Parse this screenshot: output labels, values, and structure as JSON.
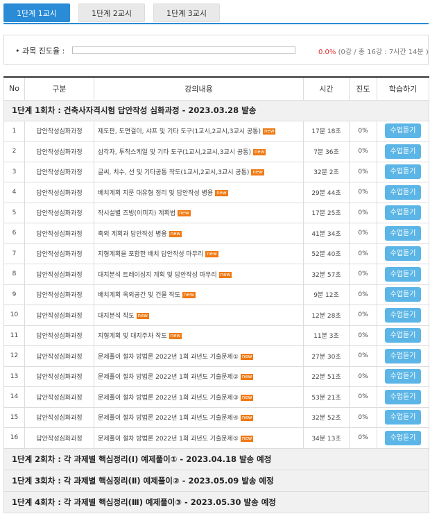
{
  "tabs": [
    {
      "label": "1단계 1교시",
      "active": true
    },
    {
      "label": "1단계 2교시",
      "active": false
    },
    {
      "label": "1단계 3교시",
      "active": false
    }
  ],
  "progress": {
    "label": "• 과목 진도율 :",
    "fraction": 0.0,
    "percent_text": "0.0%",
    "detail_text": "(0강 / 총 16강 : 7시간 14분 )"
  },
  "table": {
    "headers": [
      "No",
      "구분",
      "강의내용",
      "시간",
      "진도",
      "학습하기"
    ],
    "section_1": "1단계 1회차 : 건축사자격시험 답안작성 심화과정 - 2023.03.28 발송",
    "new_badge": "new",
    "watch_label": "수업듣기",
    "rows": [
      {
        "no": "1",
        "category": "답안작성심화과정",
        "title": "제도판, 도면걸이, 샤프 및 기타 도구(1교시,2교시,3교시 공통)",
        "is_new": true,
        "time": "17분 18초",
        "progress": "0%"
      },
      {
        "no": "2",
        "category": "답안작성심화과정",
        "title": "삼각자, 투착스케일 및 기타 도구(1교시,2교시,3교시 공통)",
        "is_new": true,
        "time": "7분 36초",
        "progress": "0%"
      },
      {
        "no": "3",
        "category": "답안작성심화과정",
        "title": "글씨, 치수, 선 및 기타공통 작도(1교시,2교시,3교시 공통)",
        "is_new": true,
        "time": "32분 2초",
        "progress": "0%"
      },
      {
        "no": "4",
        "category": "답안작성심화과정",
        "title": "배치계획 지문 대유형 정리 및 답안작성 병용",
        "is_new": true,
        "time": "29분 44초",
        "progress": "0%"
      },
      {
        "no": "5",
        "category": "답안작성심화과정",
        "title": "작시설별 즈빙(이미지) 계획법",
        "is_new": true,
        "time": "17분 25초",
        "progress": "0%"
      },
      {
        "no": "6",
        "category": "답안작성심화과정",
        "title": "축외 계획과 답안작성 병용",
        "is_new": true,
        "time": "41분 34초",
        "progress": "0%"
      },
      {
        "no": "7",
        "category": "답안작성심화과정",
        "title": "지형계획을 포함한 배치 답안작성 마무리",
        "is_new": true,
        "time": "52분 40초",
        "progress": "0%"
      },
      {
        "no": "8",
        "category": "답안작성심화과정",
        "title": "대지분석 트레이싱지 계획 및 답안작성 마무리",
        "is_new": true,
        "time": "32분 57초",
        "progress": "0%"
      },
      {
        "no": "9",
        "category": "답안작성심화과정",
        "title": "배치계획 옥외공간 및 건물 작도",
        "is_new": true,
        "time": "9분 12초",
        "progress": "0%"
      },
      {
        "no": "10",
        "category": "답안작성심화과정",
        "title": "대지분석 작도",
        "is_new": true,
        "time": "12분 28초",
        "progress": "0%"
      },
      {
        "no": "11",
        "category": "답안작성심화과정",
        "title": "지형계획 및 대지주차 작도",
        "is_new": true,
        "time": "11분 3초",
        "progress": "0%"
      },
      {
        "no": "12",
        "category": "답안작성심화과정",
        "title": "문제풀이 절차 방법론 2022년 1회 과년도 기출문제①",
        "is_new": true,
        "time": "27분 30초",
        "progress": "0%"
      },
      {
        "no": "13",
        "category": "답안작성심화과정",
        "title": "문제풀이 절차 방법론 2022년 1회 과년도 기출문제②",
        "is_new": true,
        "time": "22분 51초",
        "progress": "0%"
      },
      {
        "no": "14",
        "category": "답안작성심화과정",
        "title": "문제풀이 절차 방법론 2022년 1회 과년도 기출문제③",
        "is_new": true,
        "time": "53분 21초",
        "progress": "0%"
      },
      {
        "no": "15",
        "category": "답안작성심화과정",
        "title": "문제풀이 절차 방법론 2022년 1회 과년도 기출문제④",
        "is_new": true,
        "time": "32분 52초",
        "progress": "0%"
      },
      {
        "no": "16",
        "category": "답안작성심화과정",
        "title": "문제풀이 절차 방법론 2022년 1회 과년도 기출문제⑤",
        "is_new": true,
        "time": "34분 13초",
        "progress": "0%"
      }
    ],
    "upcoming_sections": [
      "1단계 2회차 : 각 과제별 핵심정리(Ⅰ) 예제풀이① - 2023.04.18 발송 예정",
      "1단계 3회차 : 각 과제별 핵심정리(Ⅱ) 예제풀이② - 2023.05.09 발송 예정",
      "1단계 4회차 : 각 과제별 핵심정리(Ⅲ) 예제풀이③ - 2023.05.30 발송 예정"
    ]
  },
  "colors": {
    "accent": "#2a8bd6",
    "watch_button": "#5bb5e6",
    "new_badge": "#f07a13",
    "percent_red": "#e0312f"
  }
}
